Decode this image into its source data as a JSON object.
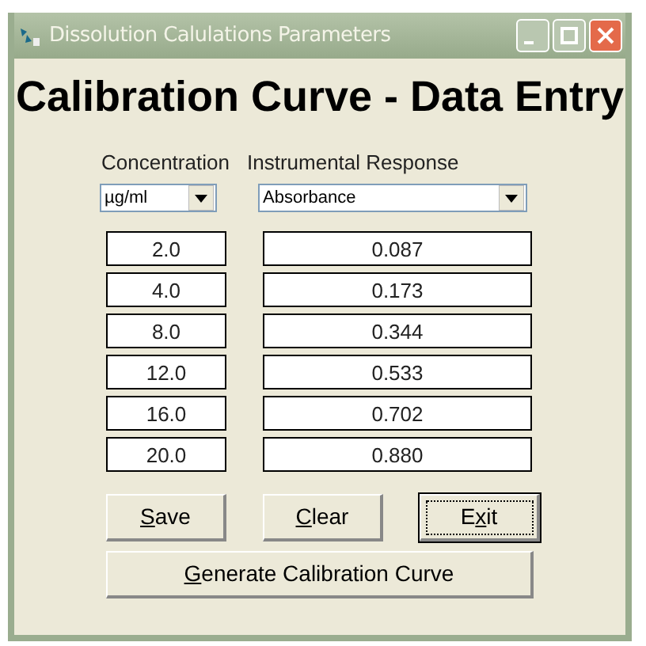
{
  "window": {
    "title": "Dissolution Calulations Parameters",
    "active": false
  },
  "heading": "Calibration Curve - Data Entry",
  "columns": [
    {
      "label": "Concentration",
      "unit": "µg/ml"
    },
    {
      "label": "Instrumental Response",
      "unit": "Absorbance"
    }
  ],
  "rows": [
    {
      "concentration": "2.0",
      "response": "0.087"
    },
    {
      "concentration": "4.0",
      "response": "0.173"
    },
    {
      "concentration": "8.0",
      "response": "0.344"
    },
    {
      "concentration": "12.0",
      "response": "0.533"
    },
    {
      "concentration": "16.0",
      "response": "0.702"
    },
    {
      "concentration": "20.0",
      "response": "0.880"
    }
  ],
  "buttons": [
    {
      "key": "S",
      "after": "ave",
      "focused": false
    },
    {
      "key": "C",
      "after": "lear",
      "focused": false
    },
    {
      "before": "E",
      "key": "x",
      "after": "it",
      "focused": true
    }
  ],
  "generate_button": {
    "key": "G",
    "after": "enerate Calibration Curve",
    "focused": false
  }
}
